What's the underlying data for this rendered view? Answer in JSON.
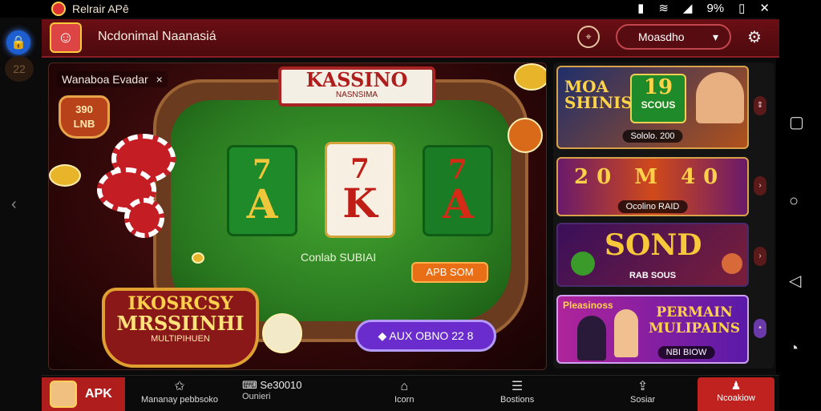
{
  "status_bar": {
    "app_name": "Relrair APê",
    "battery": "9%",
    "icons": [
      "phone-icon",
      "wifi-icon",
      "signal-icon",
      "battery-icon",
      "close-icon"
    ]
  },
  "header": {
    "title": "Ncdonimal Naanasiá",
    "dropdown_label": "Moasdho",
    "icons": [
      "location-icon",
      "settings-icon"
    ]
  },
  "left_rail": {
    "badge": "22"
  },
  "game": {
    "tag": "Wanaboa Evadar",
    "tag_close": "×",
    "badge_line1": "390",
    "badge_line2": "LNB",
    "banner_title": "KASSINO",
    "banner_sub": "NASNSIMA",
    "cards": [
      {
        "small": "7",
        "letter": "A"
      },
      {
        "small": "7",
        "letter": "K"
      },
      {
        "small": "7",
        "letter": "A"
      }
    ],
    "subtext": "Conlab SUBIAI",
    "spin_button": "APB SOM",
    "logo_line1": "IKOSRCSY",
    "logo_line2": "MRSSIINHI",
    "logo_line3": "MULTIPIHUEN",
    "cta_button": "AUX OBNO 22 8"
  },
  "side_cards": [
    {
      "title": "MOA SHINIS",
      "number": "19",
      "number_sub": "SCOUS",
      "caption": "Sololo. 200"
    },
    {
      "title": "20 M 40",
      "caption": "Ocolino RAID"
    },
    {
      "title": "SOND",
      "caption": "RAB SOUS"
    },
    {
      "title": "PERMAIN MULIPAINS",
      "prefix": "Pleasinoss",
      "caption": "NBI BIOW"
    }
  ],
  "bottom_nav": {
    "apk_label": "APK",
    "item1": "Mananay pebbsoko",
    "item2_main": "Se30010",
    "item2_sub": "Ounieri",
    "item3": "Icorn",
    "item4": "Bostions",
    "item5": "Sosiar",
    "red_button": "Ncoakiow"
  }
}
